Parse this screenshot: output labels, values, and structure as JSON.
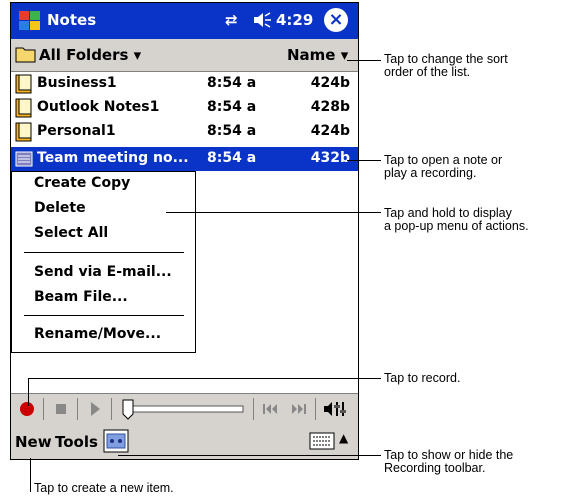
{
  "app": {
    "title": "Notes",
    "time": "4:29",
    "close_label": "×"
  },
  "toolbar": {
    "folders_label": "All Folders",
    "sort_label": "Name"
  },
  "notes": [
    {
      "name": "Business1",
      "time": "8:54 a",
      "size": "424b"
    },
    {
      "name": "Outlook Notes1",
      "time": "8:54 a",
      "size": "428b"
    },
    {
      "name": "Personal1",
      "time": "8:54 a",
      "size": "424b"
    },
    {
      "name": "Team meeting no...",
      "time": "8:54 a",
      "size": "432b"
    }
  ],
  "context_menu": {
    "items": [
      "Create Copy",
      "Delete",
      "Select All",
      "Send via E-mail...",
      "Beam File...",
      "Rename/Move..."
    ]
  },
  "command_bar": {
    "new_label": "New",
    "tools_label": "Tools"
  },
  "callouts": {
    "sort": [
      "Tap to change the sort",
      "order of the list."
    ],
    "open": [
      "Tap to open a note or",
      "play a recording."
    ],
    "hold": [
      "Tap and hold to display",
      "a pop-up menu of actions."
    ],
    "record": "Tap to record.",
    "toggle": [
      "Tap to show or hide the",
      "Recording toolbar."
    ],
    "create": "Tap to create a new item."
  },
  "colors": {
    "titlebar": "#0a33c7",
    "selection": "#0a33c7",
    "toolbar": "#d6d3ce",
    "record": "#cc0000"
  },
  "icons": [
    "windows-start-icon",
    "connectivity-icon",
    "volume-icon",
    "close-icon",
    "folder-icon",
    "note-icon",
    "record-icon",
    "stop-icon",
    "play-icon",
    "position-slider",
    "skip-back-icon",
    "skip-forward-icon",
    "volume-adjust-icon",
    "recording-toolbar-icon",
    "keyboard-icon",
    "input-menu-arrow-icon"
  ]
}
